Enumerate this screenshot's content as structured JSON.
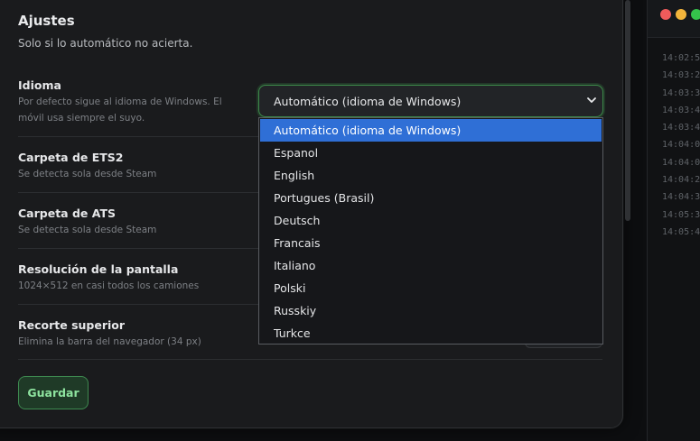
{
  "settings": {
    "title": "Ajustes",
    "subtitle": "Solo si lo automático no acierta.",
    "idioma": {
      "label": "Idioma",
      "description": "Por defecto sigue al idioma de Windows. El móvil usa siempre el suyo.",
      "selected": "Automático (idioma de Windows)",
      "options": [
        "Automático (idioma de Windows)",
        "Espanol",
        "English",
        "Portugues (Brasil)",
        "Deutsch",
        "Francais",
        "Italiano",
        "Polski",
        "Russkiy",
        "Turkce"
      ]
    },
    "ets2": {
      "label": "Carpeta de ETS2",
      "description": "Se detecta sola desde Steam"
    },
    "ats": {
      "label": "Carpeta de ATS",
      "description": "Se detecta sola desde Steam"
    },
    "resolucion": {
      "label": "Resolución de la pantalla",
      "description": "1024×512 en casi todos los camiones"
    },
    "recorte": {
      "label": "Recorte superior",
      "description": "Elimina la barra del navegador (34 px)"
    },
    "save_label": "Guardar"
  },
  "log": {
    "lines": [
      "14:02:5",
      "14:03:2",
      "14:03:3",
      "14:03:4",
      "14:03:4",
      "14:04:0",
      "14:04:0",
      "14:04:2",
      "14:04:3",
      "14:05:3",
      "14:05:4"
    ]
  },
  "colors": {
    "accent_green": "#3e8a50",
    "selected_blue": "#2f6fd6",
    "traffic_red": "#ef5b5b",
    "traffic_yellow": "#f3b43b",
    "traffic_green": "#35c24b"
  }
}
